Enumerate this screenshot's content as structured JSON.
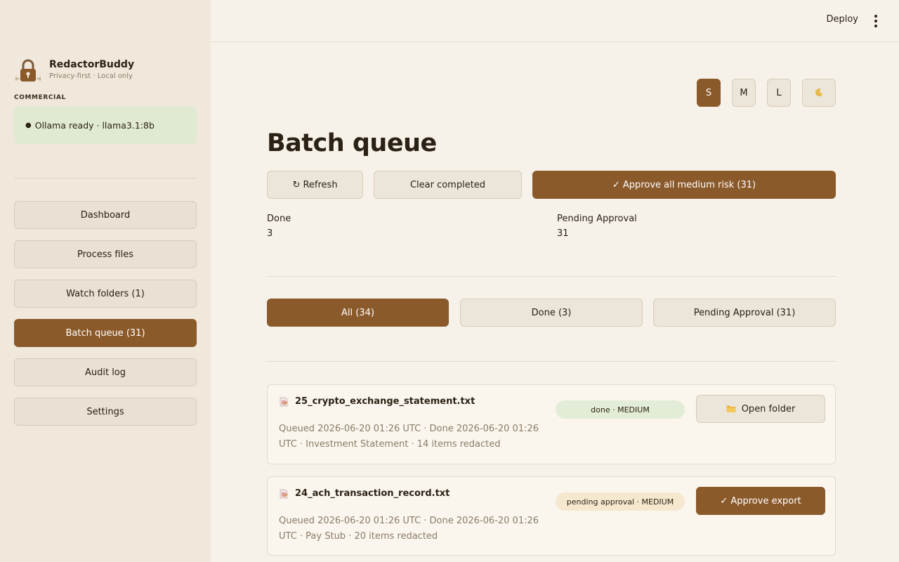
{
  "sidebar": {
    "brand_name": "RedactorBuddy",
    "brand_tagline": "Privacy-first · Local only",
    "license": "COMMERCIAL",
    "status_text": "Ollama ready · llama3.1:8b",
    "nav": [
      {
        "label": "Dashboard"
      },
      {
        "label": "Process files"
      },
      {
        "label": "Watch folders (1)"
      },
      {
        "label": "Batch queue (31)"
      },
      {
        "label": "Audit log"
      },
      {
        "label": "Settings"
      }
    ],
    "active_index": 3
  },
  "header": {
    "deploy_label": "Deploy"
  },
  "size_switch": {
    "small": "S",
    "medium": "M",
    "large": "L",
    "theme_icon": "moon-icon",
    "active": "S"
  },
  "main": {
    "title": "Batch queue",
    "actions": {
      "refresh": "↻ Refresh",
      "clear_completed": "Clear completed",
      "approve_all": "✓ Approve all medium risk (31)"
    },
    "metrics": [
      {
        "label": "Done",
        "value": "3"
      },
      {
        "label": "Pending Approval",
        "value": "31"
      }
    ],
    "filters": [
      {
        "label": "All (34)"
      },
      {
        "label": "Done (3)"
      },
      {
        "label": "Pending Approval (31)"
      }
    ],
    "active_filter": 0,
    "jobs": [
      {
        "file": "25_crypto_exchange_statement.txt",
        "meta": "Queued 2026-06-20 01:26 UTC · Done 2026-06-20 01:26 UTC · Investment Statement · 14 items redacted",
        "badge": "done · MEDIUM",
        "action": "Open folder",
        "state": "done"
      },
      {
        "file": "24_ach_transaction_record.txt",
        "meta": "Queued 2026-06-20 01:26 UTC · Done 2026-06-20 01:26 UTC · Pay Stub · 20 items redacted",
        "badge": "pending approval · MEDIUM",
        "action": "✓ Approve export",
        "state": "pending"
      }
    ]
  },
  "colors": {
    "accent": "#8b5a2b",
    "sidebar_bg": "#f0e8da",
    "page_bg": "#f7f2e9",
    "status_ok_bg": "#e0ead3",
    "pending_bg": "#f6e8cf"
  }
}
